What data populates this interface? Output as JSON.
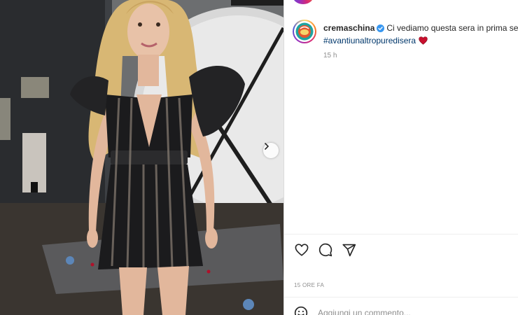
{
  "post": {
    "image_alt": "Woman in black sequin striped mini dress",
    "next_icon": "chevron-right-icon"
  },
  "account": {
    "username": "cremaschina",
    "verified": true,
    "avatar_icon": "avatar-logo"
  },
  "caption": {
    "text": "Ci vediamo questa sera in prima serata",
    "hashtag": "#avantiunaltropuredisera",
    "emoji": "heart-emoji",
    "time": "15 h"
  },
  "actions": {
    "like_icon": "heart-icon",
    "comment_icon": "comment-icon",
    "share_icon": "share-icon"
  },
  "timestamp": "15 ORE FA",
  "comment": {
    "placeholder": "Aggiungi un commento...",
    "emoji_icon": "smiley-icon"
  },
  "colors": {
    "hashtag": "#00376b",
    "verified": "#3897f0",
    "heart": "#ed4956",
    "muted": "#8e8e8e"
  }
}
